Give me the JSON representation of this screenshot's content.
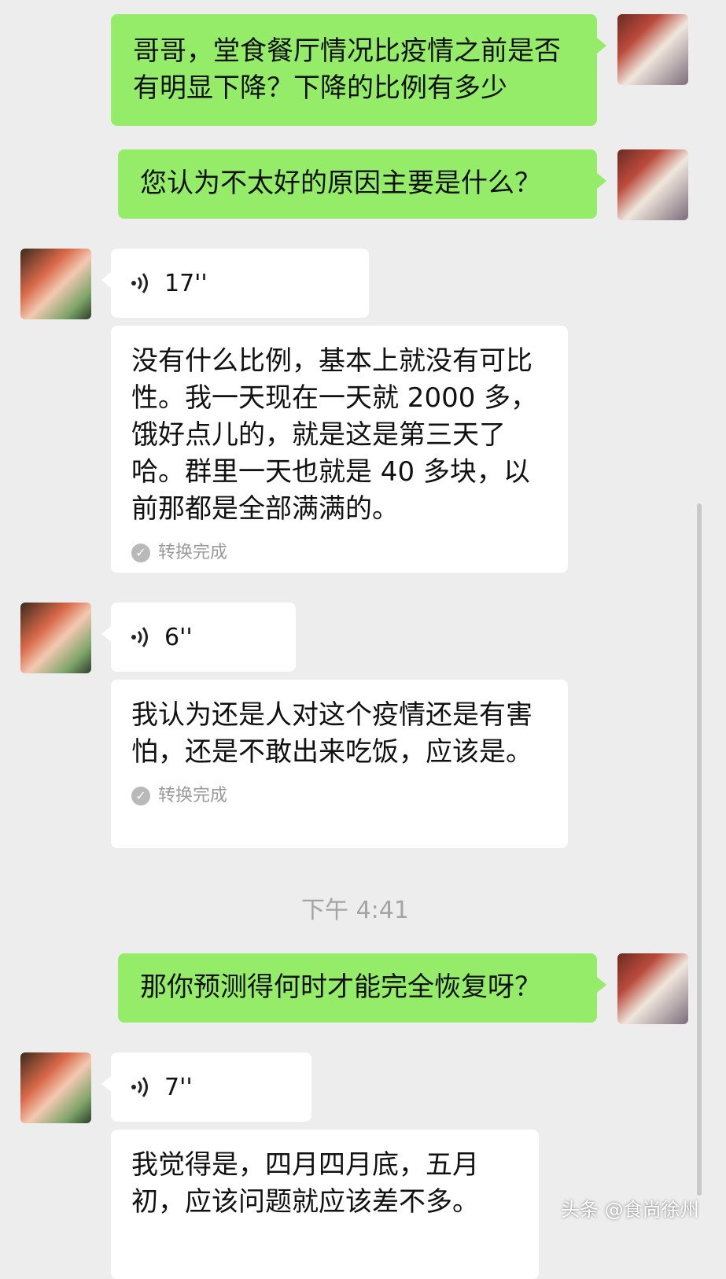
{
  "messages": [
    {
      "text": "哥哥，堂食餐厅情况比疫情之前是否有明显下降？下降的比例有多少"
    },
    {
      "text": "您认为不太好的原因主要是什么？"
    },
    {
      "voice_duration": "17''",
      "transcript": "没有什么比例，基本上就没有可比性。我一天现在一天就 2000 多，饿好点儿的，就是这是第三天了哈。群里一天也就是 40 多块，以前那都是全部满满的。",
      "status": "转换完成"
    },
    {
      "voice_duration": "6''",
      "transcript": "我认为还是人对这个疫情还是有害怕，还是不敢出来吃饭，应该是。",
      "status": "转换完成"
    },
    {
      "text": "那你预测得何时才能完全恢复呀？"
    },
    {
      "voice_duration": "7''",
      "transcript": "我觉得是，四月四月底，五月初，应该问题就应该差不多。"
    }
  ],
  "timestamp": "下午 4:41",
  "watermark": "头条 @食尚徐州",
  "colors": {
    "self_bubble": "#95ec69",
    "other_bubble": "#ffffff",
    "background": "#ededed"
  }
}
